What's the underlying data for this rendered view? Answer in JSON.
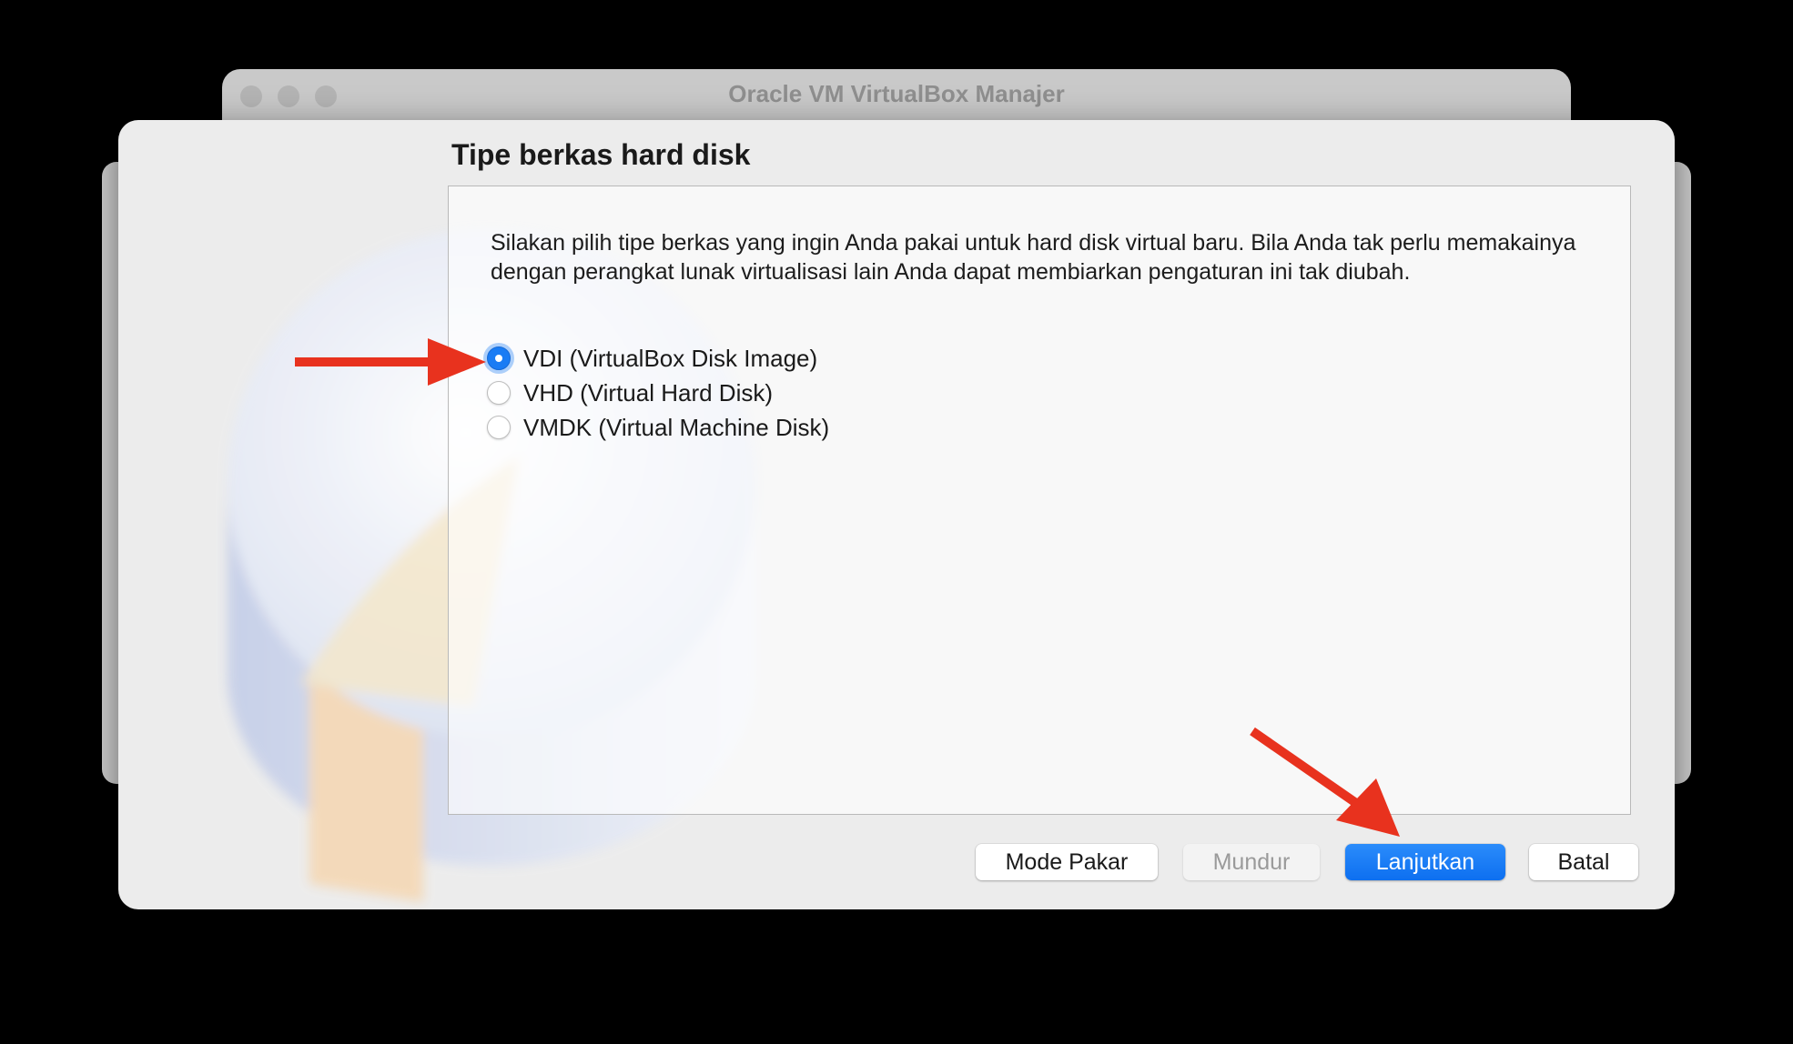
{
  "background_window": {
    "title": "Oracle VM VirtualBox Manajer"
  },
  "dialog": {
    "page_title": "Tipe berkas hard disk",
    "description": "Silakan pilih tipe berkas yang ingin Anda pakai untuk hard disk virtual baru. Bila Anda tak perlu memakainya dengan perangkat lunak virtualisasi lain Anda dapat membiarkan pengaturan ini tak diubah.",
    "options": [
      {
        "label": "VDI (VirtualBox Disk Image)",
        "checked": true
      },
      {
        "label": "VHD (Virtual Hard Disk)",
        "checked": false
      },
      {
        "label": "VMDK (Virtual Machine Disk)",
        "checked": false
      }
    ],
    "buttons": {
      "expert_mode": "Mode Pakar",
      "back": "Mundur",
      "next": "Lanjutkan",
      "cancel": "Batal"
    }
  },
  "colors": {
    "accent": "#1a7cf4",
    "annotation_arrow": "#e8321e"
  }
}
